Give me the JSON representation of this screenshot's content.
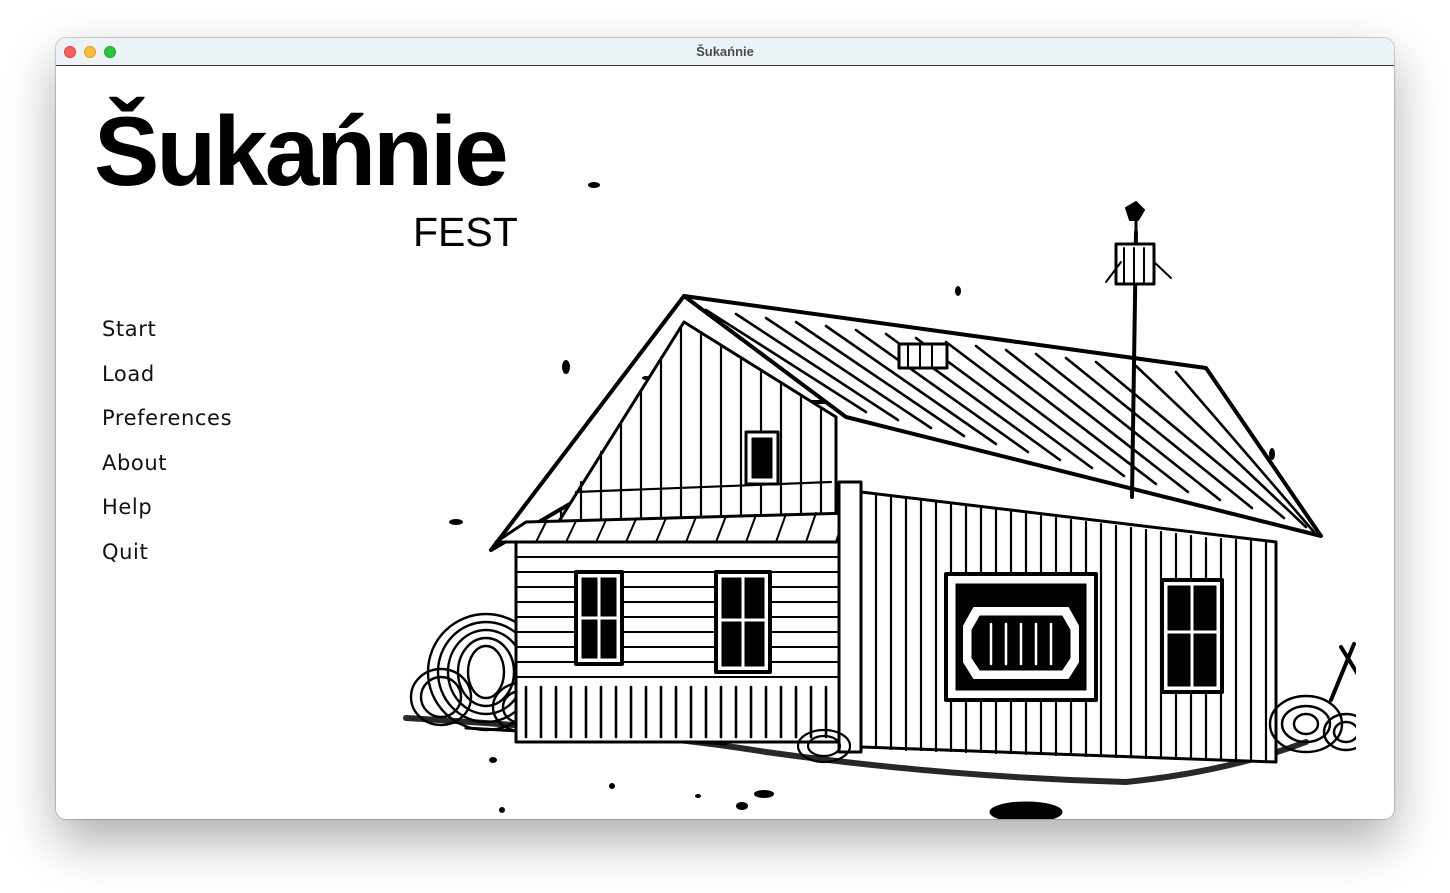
{
  "window": {
    "title": "Šukańnie"
  },
  "logo": {
    "title": "Šukańnie",
    "subtitle": "FEST"
  },
  "main_menu": {
    "items": [
      {
        "label": "Start"
      },
      {
        "label": "Load"
      },
      {
        "label": "Preferences"
      },
      {
        "label": "About"
      },
      {
        "label": "Help"
      },
      {
        "label": "Quit"
      }
    ]
  },
  "theme": {
    "background": "#ffffff",
    "ink": "#000000",
    "titlebar": "#ecf3f6",
    "traffic_close": "#ff5f57",
    "traffic_minimize": "#febc2e",
    "traffic_maximize": "#28c840"
  },
  "illustration": {
    "subject": "ink-drawing-wooden-house"
  }
}
